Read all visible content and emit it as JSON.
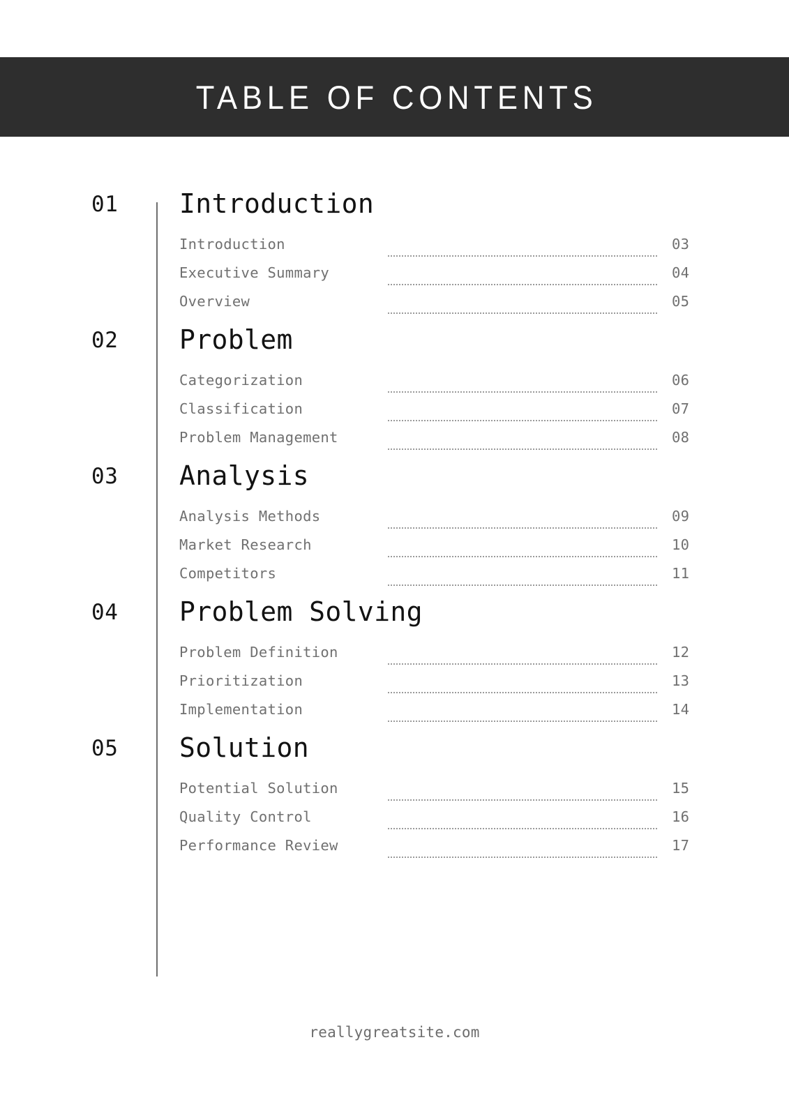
{
  "page": {
    "background_color": "#ffffff"
  },
  "header": {
    "title": "TABLE OF CONTENTS",
    "background_color": "#2e2e2e",
    "text_color": "#ffffff"
  },
  "toc": {
    "sections": [
      {
        "number": "01",
        "title": "Introduction",
        "items": [
          {
            "label": "Introduction",
            "page": "03"
          },
          {
            "label": "Executive Summary",
            "page": "04"
          },
          {
            "label": "Overview",
            "page": "05"
          }
        ]
      },
      {
        "number": "02",
        "title": "Problem",
        "items": [
          {
            "label": "Categorization",
            "page": "06"
          },
          {
            "label": "Classification",
            "page": "07"
          },
          {
            "label": "Problem Management",
            "page": "08"
          }
        ]
      },
      {
        "number": "03",
        "title": "Analysis",
        "items": [
          {
            "label": "Analysis Methods",
            "page": "09"
          },
          {
            "label": "Market Research",
            "page": "10"
          },
          {
            "label": "Competitors",
            "page": "11"
          }
        ]
      },
      {
        "number": "04",
        "title": "Problem Solving",
        "items": [
          {
            "label": "Problem Definition",
            "page": "12"
          },
          {
            "label": "Prioritization",
            "page": "13"
          },
          {
            "label": "Implementation",
            "page": "14"
          }
        ]
      },
      {
        "number": "05",
        "title": "Solution",
        "items": [
          {
            "label": "Potential Solution",
            "page": "15"
          },
          {
            "label": "Quality Control",
            "page": "16"
          },
          {
            "label": "Performance Review",
            "page": "17"
          }
        ]
      }
    ]
  },
  "footer": {
    "website": "reallygreatsite.com"
  }
}
